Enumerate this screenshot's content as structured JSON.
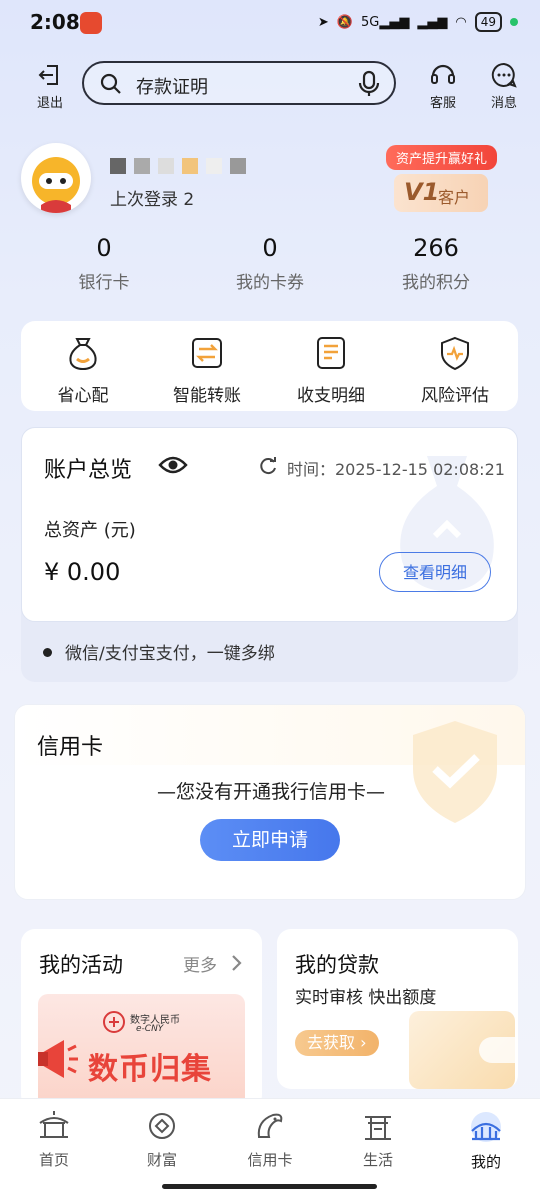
{
  "status_bar": {
    "time": "2:08",
    "network": "5G",
    "battery": "49"
  },
  "top_bar": {
    "exit_label": "退出",
    "search_text": "存款证明",
    "service_label": "客服",
    "message_label": "消息"
  },
  "profile": {
    "last_login": "上次登录 2",
    "promo": "资产提升赢好礼",
    "level": "V1",
    "level_suffix": "客户"
  },
  "stats": [
    {
      "value": "0",
      "label": "银行卡"
    },
    {
      "value": "0",
      "label": "我的卡券"
    },
    {
      "value": "266",
      "label": "我的积分"
    }
  ],
  "quick_actions": [
    {
      "label": "省心配",
      "icon": "bag-icon"
    },
    {
      "label": "智能转账",
      "icon": "transfer-icon"
    },
    {
      "label": "收支明细",
      "icon": "statement-icon"
    },
    {
      "label": "风险评估",
      "icon": "shield-pulse-icon"
    }
  ],
  "account": {
    "title": "账户总览",
    "time_text": "时间：2025-12-15 02:08:21",
    "total_label": "总资产 (元)",
    "total_value": "¥ 0.00",
    "detail_button": "查看明细",
    "bind_text": "微信/支付宝支付，一键多绑"
  },
  "credit_card": {
    "title": "信用卡",
    "message": "—您没有开通我行信用卡—",
    "apply_button": "立即申请"
  },
  "activities": {
    "title": "我的活动",
    "more": "更多",
    "banner_brand": "数字人民币",
    "banner_brand_en": "e-CNY",
    "banner_title": "数币归集"
  },
  "loan": {
    "title": "我的贷款",
    "subtitle": "实时审核 快出额度",
    "button": "去获取"
  },
  "tabs": [
    {
      "label": "首页"
    },
    {
      "label": "财富"
    },
    {
      "label": "信用卡"
    },
    {
      "label": "生活"
    },
    {
      "label": "我的"
    }
  ]
}
